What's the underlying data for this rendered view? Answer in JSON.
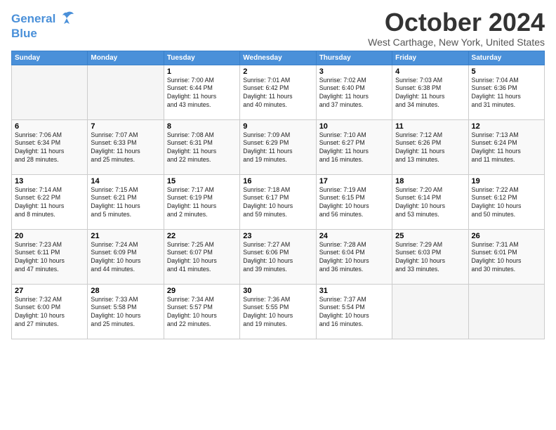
{
  "header": {
    "logo_line1": "General",
    "logo_line2": "Blue",
    "month": "October 2024",
    "location": "West Carthage, New York, United States"
  },
  "weekdays": [
    "Sunday",
    "Monday",
    "Tuesday",
    "Wednesday",
    "Thursday",
    "Friday",
    "Saturday"
  ],
  "weeks": [
    [
      {
        "day": null
      },
      {
        "day": null
      },
      {
        "day": 1,
        "sunrise": "7:00 AM",
        "sunset": "6:44 PM",
        "daylight": "11 hours and 43 minutes."
      },
      {
        "day": 2,
        "sunrise": "7:01 AM",
        "sunset": "6:42 PM",
        "daylight": "11 hours and 40 minutes."
      },
      {
        "day": 3,
        "sunrise": "7:02 AM",
        "sunset": "6:40 PM",
        "daylight": "11 hours and 37 minutes."
      },
      {
        "day": 4,
        "sunrise": "7:03 AM",
        "sunset": "6:38 PM",
        "daylight": "11 hours and 34 minutes."
      },
      {
        "day": 5,
        "sunrise": "7:04 AM",
        "sunset": "6:36 PM",
        "daylight": "11 hours and 31 minutes."
      }
    ],
    [
      {
        "day": 6,
        "sunrise": "7:06 AM",
        "sunset": "6:34 PM",
        "daylight": "11 hours and 28 minutes."
      },
      {
        "day": 7,
        "sunrise": "7:07 AM",
        "sunset": "6:33 PM",
        "daylight": "11 hours and 25 minutes."
      },
      {
        "day": 8,
        "sunrise": "7:08 AM",
        "sunset": "6:31 PM",
        "daylight": "11 hours and 22 minutes."
      },
      {
        "day": 9,
        "sunrise": "7:09 AM",
        "sunset": "6:29 PM",
        "daylight": "11 hours and 19 minutes."
      },
      {
        "day": 10,
        "sunrise": "7:10 AM",
        "sunset": "6:27 PM",
        "daylight": "11 hours and 16 minutes."
      },
      {
        "day": 11,
        "sunrise": "7:12 AM",
        "sunset": "6:26 PM",
        "daylight": "11 hours and 13 minutes."
      },
      {
        "day": 12,
        "sunrise": "7:13 AM",
        "sunset": "6:24 PM",
        "daylight": "11 hours and 11 minutes."
      }
    ],
    [
      {
        "day": 13,
        "sunrise": "7:14 AM",
        "sunset": "6:22 PM",
        "daylight": "11 hours and 8 minutes."
      },
      {
        "day": 14,
        "sunrise": "7:15 AM",
        "sunset": "6:21 PM",
        "daylight": "11 hours and 5 minutes."
      },
      {
        "day": 15,
        "sunrise": "7:17 AM",
        "sunset": "6:19 PM",
        "daylight": "11 hours and 2 minutes."
      },
      {
        "day": 16,
        "sunrise": "7:18 AM",
        "sunset": "6:17 PM",
        "daylight": "10 hours and 59 minutes."
      },
      {
        "day": 17,
        "sunrise": "7:19 AM",
        "sunset": "6:15 PM",
        "daylight": "10 hours and 56 minutes."
      },
      {
        "day": 18,
        "sunrise": "7:20 AM",
        "sunset": "6:14 PM",
        "daylight": "10 hours and 53 minutes."
      },
      {
        "day": 19,
        "sunrise": "7:22 AM",
        "sunset": "6:12 PM",
        "daylight": "10 hours and 50 minutes."
      }
    ],
    [
      {
        "day": 20,
        "sunrise": "7:23 AM",
        "sunset": "6:11 PM",
        "daylight": "10 hours and 47 minutes."
      },
      {
        "day": 21,
        "sunrise": "7:24 AM",
        "sunset": "6:09 PM",
        "daylight": "10 hours and 44 minutes."
      },
      {
        "day": 22,
        "sunrise": "7:25 AM",
        "sunset": "6:07 PM",
        "daylight": "10 hours and 41 minutes."
      },
      {
        "day": 23,
        "sunrise": "7:27 AM",
        "sunset": "6:06 PM",
        "daylight": "10 hours and 39 minutes."
      },
      {
        "day": 24,
        "sunrise": "7:28 AM",
        "sunset": "6:04 PM",
        "daylight": "10 hours and 36 minutes."
      },
      {
        "day": 25,
        "sunrise": "7:29 AM",
        "sunset": "6:03 PM",
        "daylight": "10 hours and 33 minutes."
      },
      {
        "day": 26,
        "sunrise": "7:31 AM",
        "sunset": "6:01 PM",
        "daylight": "10 hours and 30 minutes."
      }
    ],
    [
      {
        "day": 27,
        "sunrise": "7:32 AM",
        "sunset": "6:00 PM",
        "daylight": "10 hours and 27 minutes."
      },
      {
        "day": 28,
        "sunrise": "7:33 AM",
        "sunset": "5:58 PM",
        "daylight": "10 hours and 25 minutes."
      },
      {
        "day": 29,
        "sunrise": "7:34 AM",
        "sunset": "5:57 PM",
        "daylight": "10 hours and 22 minutes."
      },
      {
        "day": 30,
        "sunrise": "7:36 AM",
        "sunset": "5:55 PM",
        "daylight": "10 hours and 19 minutes."
      },
      {
        "day": 31,
        "sunrise": "7:37 AM",
        "sunset": "5:54 PM",
        "daylight": "10 hours and 16 minutes."
      },
      {
        "day": null
      },
      {
        "day": null
      }
    ]
  ]
}
